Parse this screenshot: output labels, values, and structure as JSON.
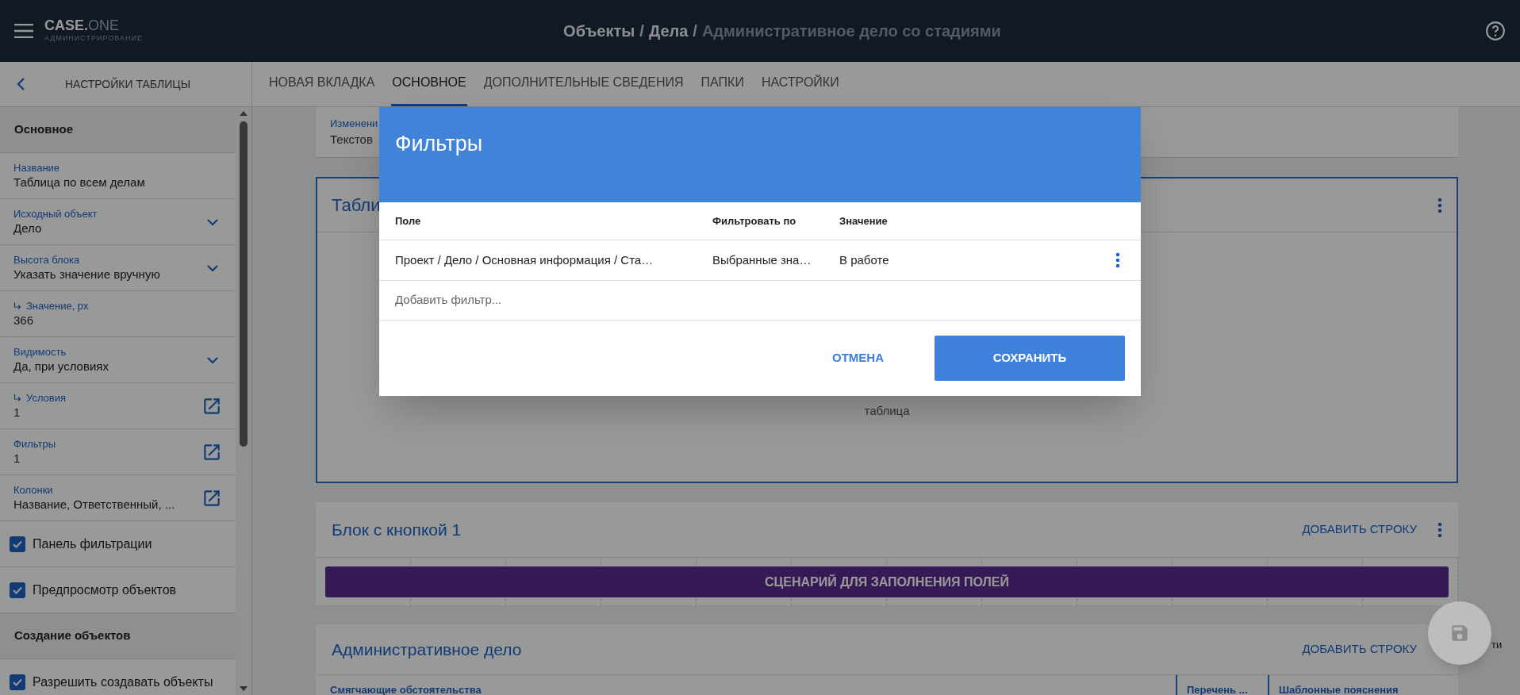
{
  "app": {
    "logo_main": "CASE.",
    "logo_accent": "ONE",
    "subtitle": "АДМИНИСТРИРОВАНИЕ"
  },
  "breadcrumb": {
    "separator": "/",
    "items": [
      {
        "text": "Объекты",
        "current": false
      },
      {
        "text": "Дела",
        "current": false
      },
      {
        "text": "Административное дело со стадиями",
        "current": true
      }
    ]
  },
  "sidebar": {
    "title": "НАСТРОЙКИ ТАБЛИЦЫ",
    "items": [
      {
        "kind": "section",
        "label": "Основное"
      },
      {
        "kind": "field",
        "label": "Название",
        "value": "Таблица по всем делам",
        "indented": false
      },
      {
        "kind": "select",
        "label": "Исходный объект",
        "value": "Дело",
        "indented": false
      },
      {
        "kind": "select",
        "label": "Высота блока",
        "value": "Указать значение вручную",
        "indented": false
      },
      {
        "kind": "field",
        "label": "Значение, px",
        "value": "366",
        "indented": true
      },
      {
        "kind": "select",
        "label": "Видимость",
        "value": "Да, при условиях",
        "indented": false
      },
      {
        "kind": "link",
        "label": "Условия",
        "value": "1",
        "indented": true
      },
      {
        "kind": "link",
        "label": "Фильтры",
        "value": "1",
        "indented": false
      },
      {
        "kind": "link",
        "label": "Колонки",
        "value": "Название, Ответственный, ...",
        "indented": false
      },
      {
        "kind": "checkbox",
        "label": "Панель фильтрации",
        "checked": true
      },
      {
        "kind": "checkbox",
        "label": "Предпросмотр объектов",
        "checked": true
      },
      {
        "kind": "section",
        "label": "Создание объектов"
      },
      {
        "kind": "checkbox",
        "label": "Разрешить создавать объекты",
        "checked": true
      }
    ]
  },
  "tabs": [
    {
      "label": "НОВАЯ ВКЛАДКА",
      "selected": false
    },
    {
      "label": "ОСНОВНОЕ",
      "selected": true
    },
    {
      "label": "ДОПОЛНИТЕЛЬНЫЕ СВЕДЕНИЯ",
      "selected": false
    },
    {
      "label": "ПАПКИ",
      "selected": false
    },
    {
      "label": "НАСТРОЙКИ",
      "selected": false
    }
  ],
  "top_card": {
    "label": "Изменени",
    "value": "Текстов"
  },
  "table_card": {
    "title": "Табли",
    "placeholder_text": "таблица"
  },
  "button_card": {
    "title": "Блок с кнопкой 1",
    "add_row": "ДОБАВИТЬ СТРОКУ",
    "scenario_button": "СЦЕНАРИЙ ДЛЯ ЗАПОЛНЕНИЯ ПОЛЕЙ"
  },
  "admin_card": {
    "title": "Административное дело",
    "add_row": "ДОБАВИТЬ СТРОКУ",
    "columns": [
      {
        "label": "Смягчающие обстоятельства"
      },
      {
        "label": "Перечень ..."
      },
      {
        "label": "Шаблонные пояснения"
      }
    ]
  },
  "fab_side_text": "ти",
  "modal": {
    "title": "Фильтры",
    "columns": [
      "Поле",
      "Фильтровать по",
      "Значение"
    ],
    "rows": [
      {
        "cells": [
          "Проект / Дело / Основная информация / Ста…",
          "Выбранные зна…",
          "В работе"
        ]
      }
    ],
    "add_placeholder": "Добавить фильтр...",
    "cancel": "ОТМЕНА",
    "save": "СОХРАНИТЬ"
  }
}
